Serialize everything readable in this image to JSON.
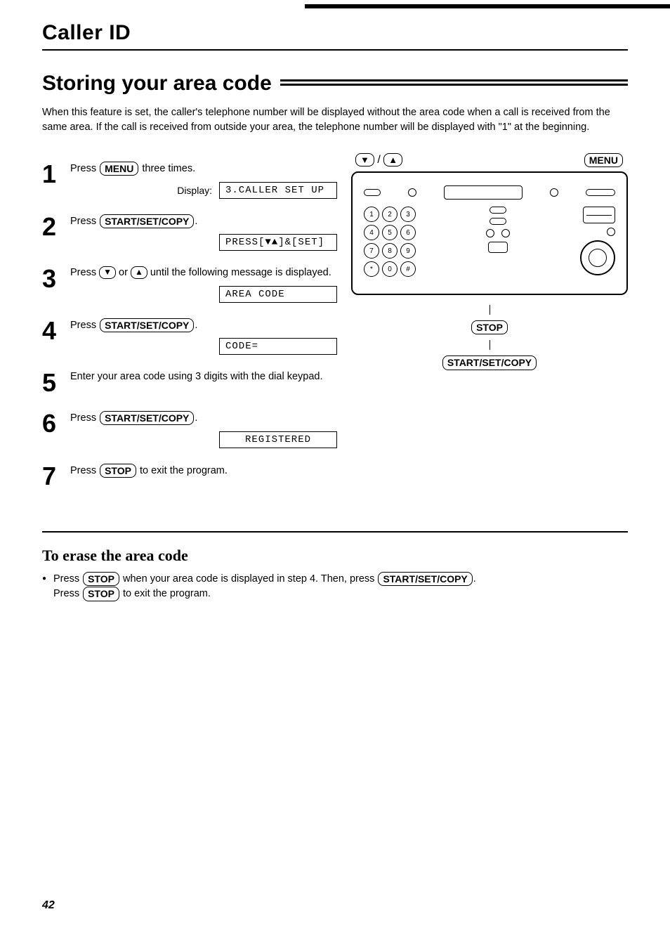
{
  "chapter_title": "Caller ID",
  "section_title": "Storing your area code",
  "intro": "When this feature is set, the caller's telephone number will be displayed without the area code when a call is received from the same area. If the call is received from outside your area, the telephone number will be displayed with \"1\" at the beginning.",
  "keys": {
    "menu": "MENU",
    "start_set_copy": "START/SET/COPY",
    "stop": "STOP"
  },
  "display_label": "Display:",
  "steps": {
    "1": {
      "num": "1",
      "text_before": "Press ",
      "text_after": " three times.",
      "lcd": "3.CALLER SET UP"
    },
    "2": {
      "num": "2",
      "text_before": "Press ",
      "text_after": ".",
      "lcd": "PRESS[▼▲]&[SET]"
    },
    "3": {
      "num": "3",
      "text_a": "Press ",
      "text_b": " or ",
      "text_c": " until the following message is displayed.",
      "lcd": "AREA CODE"
    },
    "4": {
      "num": "4",
      "text_before": "Press ",
      "text_after": ".",
      "lcd": "CODE="
    },
    "5": {
      "num": "5",
      "text": "Enter your area code using 3 digits with the dial keypad."
    },
    "6": {
      "num": "6",
      "text_before": "Press ",
      "text_after": ".",
      "lcd": "REGISTERED"
    },
    "7": {
      "num": "7",
      "text_before": "Press ",
      "text_after": " to exit the program."
    }
  },
  "device_labels": {
    "arrows": "▼ / ▲",
    "menu": "MENU",
    "stop": "STOP",
    "ssc": "START/SET/COPY"
  },
  "dial_keys": [
    "1",
    "2",
    "3",
    "4",
    "5",
    "6",
    "7",
    "8",
    "9",
    "*",
    "0",
    "□"
  ],
  "erase": {
    "title": "To erase the area code",
    "line1a": "Press ",
    "line1b": " when your area code is displayed in step 4. Then, press ",
    "line1c": ".",
    "line2a": "Press ",
    "line2b": " to exit the program."
  },
  "page_number": "42"
}
